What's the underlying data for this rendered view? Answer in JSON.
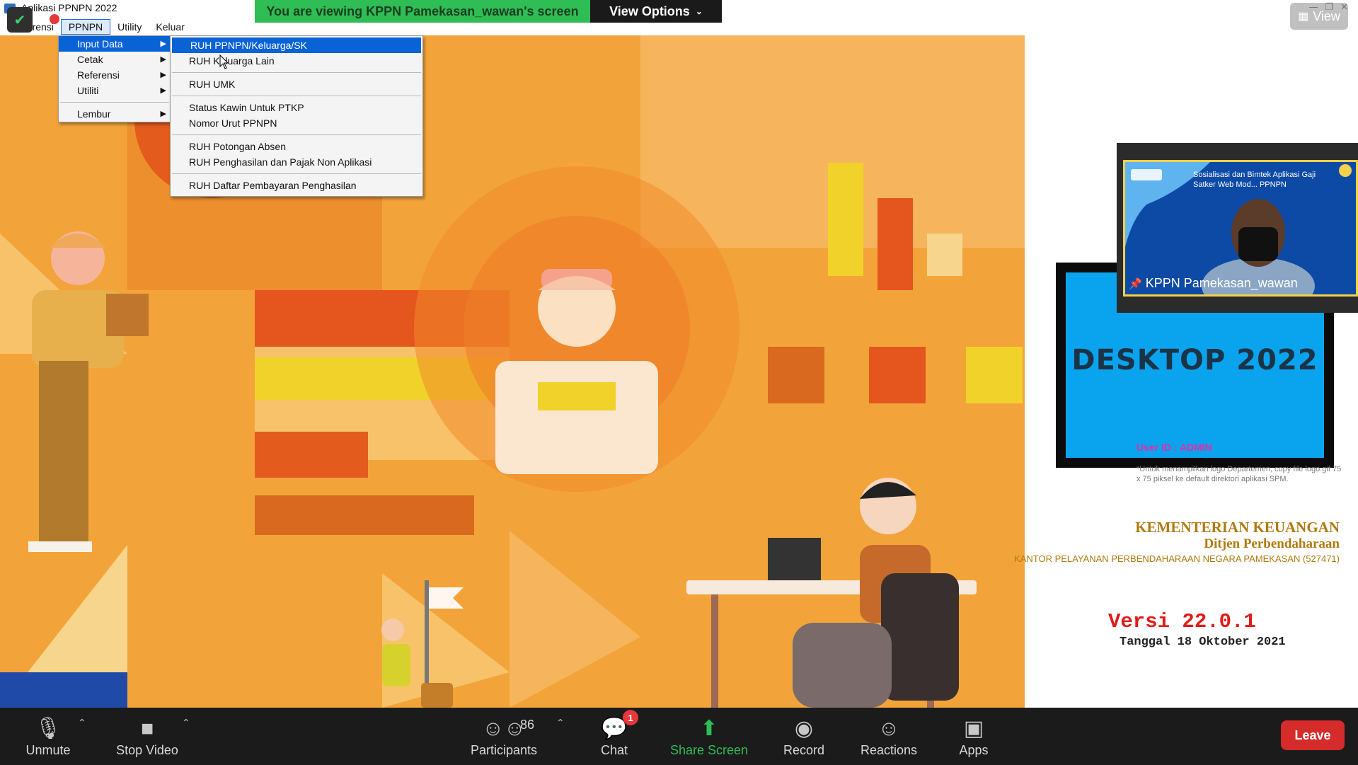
{
  "app": {
    "title": "Aplikasi PPNPN 2022",
    "menubar": [
      "Referensi",
      "PPNPN",
      "Utility",
      "Keluar"
    ],
    "active_menu": "PPNPN"
  },
  "zoom_banner": {
    "viewing_text": "You are viewing KPPN Pamekasan_wawan's screen",
    "view_options_label": "View Options",
    "view_button_label": "View",
    "recording_label": "Recording"
  },
  "ppnpn_menu": [
    {
      "label": "Input Data",
      "has_submenu": true,
      "highlighted": true
    },
    {
      "label": "Cetak",
      "has_submenu": true
    },
    {
      "label": "Referensi",
      "has_submenu": true
    },
    {
      "label": "Utiliti",
      "has_submenu": true
    },
    {
      "label": "Lembur",
      "has_submenu": true
    }
  ],
  "input_data_submenu": {
    "group1": [
      "RUH PPNPN/Keluarga/SK",
      "RUH Keluarga Lain"
    ],
    "group2": [
      "RUH UMK"
    ],
    "group3": [
      "Status Kawin Untuk PTKP",
      "Nomor Urut PPNPN"
    ],
    "group4": [
      "RUH Potongan Absen",
      "RUH Penghasilan dan Pajak Non Aplikasi"
    ],
    "group5": [
      "RUH Daftar Pembayaran Penghasilan"
    ]
  },
  "desktop_panel": {
    "card_title": "DESKTOP 2022",
    "user_id": "User ID : ADMIN",
    "logo_note": "*Untuk menampilkan logo Departemen, copy file logo.gif 75 x 75 piksel ke default direktori aplikasi SPM.",
    "ministry": "KEMENTERIAN KEUANGAN",
    "directorate": "Ditjen Perbendaharaan",
    "office": "KANTOR PELAYANAN PERBENDAHARAAN NEGARA PAMEKASAN (527471)",
    "version": "Versi 22.0.1",
    "date": "Tanggal 18 Oktober 2021"
  },
  "video_tile": {
    "slide_title": "Sosialisasi dan Bimtek Aplikasi Gaji Satker Web Mod... PPNPN",
    "participant_name": "KPPN Pamekasan_wawan"
  },
  "toolbar": {
    "unmute": "Unmute",
    "stop_video": "Stop Video",
    "participants": "Participants",
    "participants_count": "86",
    "chat": "Chat",
    "chat_badge": "1",
    "share_screen": "Share Screen",
    "record": "Record",
    "reactions": "Reactions",
    "apps": "Apps",
    "leave": "Leave"
  },
  "colors": {
    "banner_green": "#2fbd55",
    "menu_highlight": "#0a63d6",
    "share_screen_green": "#2fbd55",
    "leave_red": "#d52b2b",
    "version_red": "#e01b1b",
    "ministry_gold": "#b07a10"
  }
}
